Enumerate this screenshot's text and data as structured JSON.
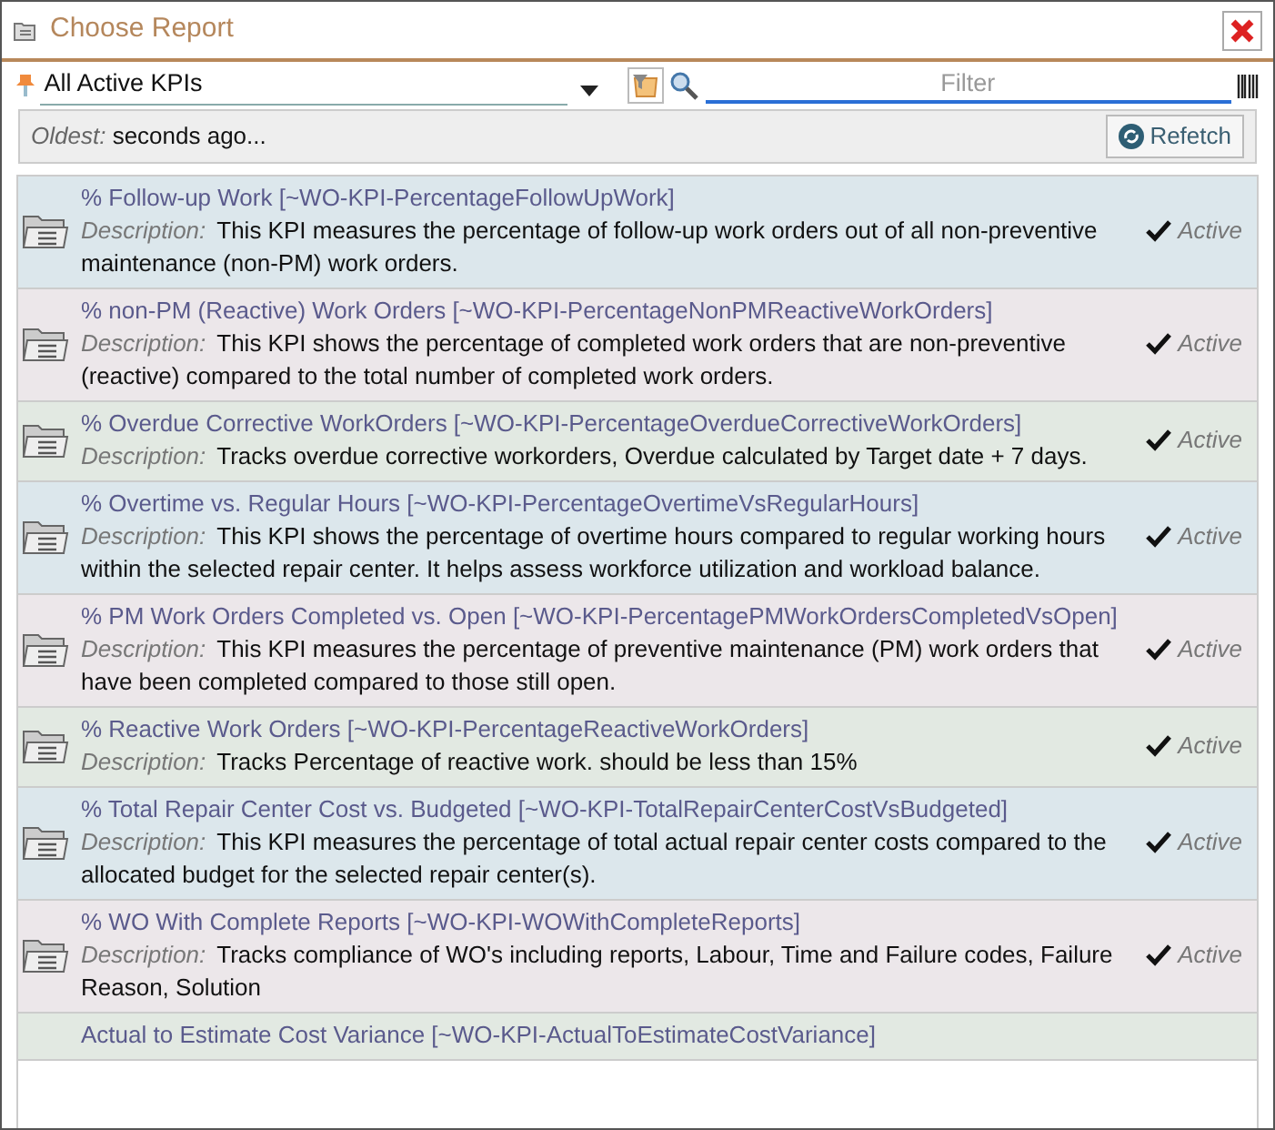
{
  "window": {
    "title": "Choose Report"
  },
  "toolbar": {
    "report_set": "All Active KPIs",
    "filter": {
      "placeholder": "Filter"
    }
  },
  "info_bar": {
    "label": "Oldest:",
    "value": "seconds ago...",
    "refetch_button": "Refetch"
  },
  "reports": [
    {
      "title": "% Follow-up Work [~WO-KPI-PercentageFollowUpWork]",
      "description_label": "Description:",
      "description": "This KPI measures the percentage of follow-up work orders out of all non-preventive maintenance (non-PM) work orders.",
      "active": true,
      "status": "Active"
    },
    {
      "title": "% non-PM (Reactive) Work Orders [~WO-KPI-PercentageNonPMReactiveWorkOrders]",
      "description_label": "Description:",
      "description": "This KPI shows the percentage of completed work orders that are non-preventive (reactive) compared to the total number of completed work orders.",
      "active": true,
      "status": "Active"
    },
    {
      "title": "% Overdue Corrective WorkOrders [~WO-KPI-PercentageOverdueCorrectiveWorkOrders]",
      "description_label": "Description:",
      "description": "Tracks overdue corrective workorders, Overdue calculated by Target date + 7 days.",
      "active": true,
      "status": "Active"
    },
    {
      "title": "% Overtime vs. Regular Hours [~WO-KPI-PercentageOvertimeVsRegularHours]",
      "description_label": "Description:",
      "description": "This KPI shows the percentage of overtime hours compared to regular working hours within the selected repair center. It helps assess workforce utilization and workload balance.",
      "active": true,
      "status": "Active"
    },
    {
      "title": "% PM Work Orders Completed vs. Open [~WO-KPI-PercentagePMWorkOrdersCompletedVsOpen]",
      "description_label": "Description:",
      "description": "This KPI measures the percentage of preventive maintenance (PM) work orders that have been completed compared to those still open.",
      "active": true,
      "status": "Active"
    },
    {
      "title": "% Reactive Work Orders [~WO-KPI-PercentageReactiveWorkOrders]",
      "description_label": "Description:",
      "description": "Tracks Percentage of reactive work. should be less than 15%",
      "active": true,
      "status": "Active"
    },
    {
      "title": "% Total Repair Center Cost vs. Budgeted [~WO-KPI-TotalRepairCenterCostVsBudgeted]",
      "description_label": "Description:",
      "description": "This KPI measures the percentage of total actual repair center costs compared to the allocated budget for the selected repair center(s).",
      "active": true,
      "status": "Active"
    },
    {
      "title": "% WO With Complete Reports [~WO-KPI-WOWithCompleteReports]",
      "description_label": "Description:",
      "description": "Tracks compliance of WO's including  reports, Labour, Time and Failure codes, Failure Reason, Solution",
      "active": true,
      "status": "Active"
    },
    {
      "title": "Actual to Estimate Cost Variance [~WO-KPI-ActualToEstimateCostVariance]"
    }
  ]
}
